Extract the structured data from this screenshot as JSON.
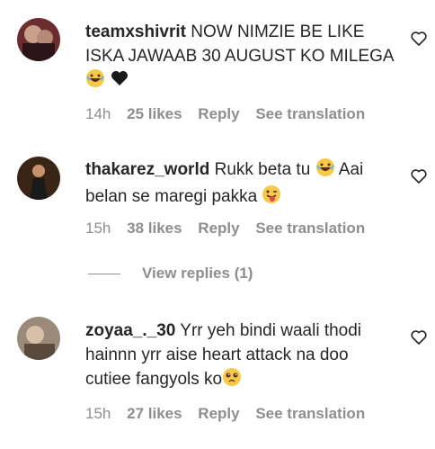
{
  "comments": [
    {
      "username": "teamxshivrit",
      "text": "NOW NIMZIE BE LIKE ISKA JAWAAB 30 AUGUST KO MILEGA",
      "time": "14h",
      "likes": "25 likes",
      "reply": "Reply",
      "translate": "See translation"
    },
    {
      "username": "thakarez_world",
      "text_a": "Rukk beta tu",
      "text_b": "Aai belan se maregi pakka",
      "time": "15h",
      "likes": "38 likes",
      "reply": "Reply",
      "translate": "See translation"
    },
    {
      "username": "zoyaa_._30",
      "text": "Yrr yeh bindi waali thodi hainnn yrr aise heart attack na doo cutiee fangyols ko",
      "time": "15h",
      "likes": "27 likes",
      "reply": "Reply",
      "translate": "See translation"
    }
  ],
  "view_replies": "View replies (1)",
  "colors": {
    "text": "#262626",
    "muted": "#8e8e8e"
  }
}
